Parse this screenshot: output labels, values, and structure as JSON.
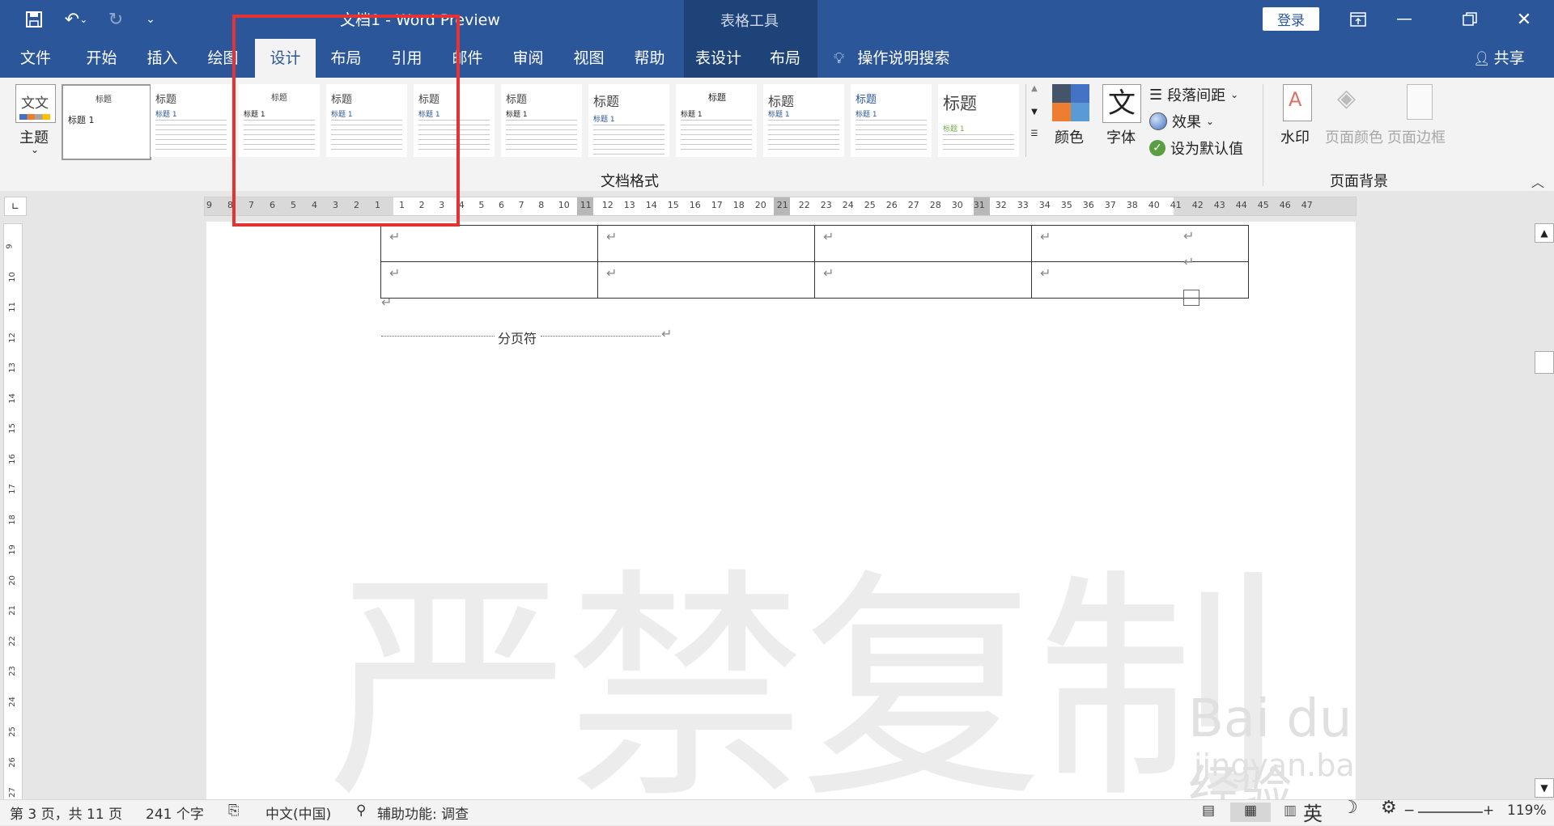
{
  "window": {
    "title": "文档1 - Word Preview",
    "contextual_group": "表格工具",
    "login": "登录"
  },
  "quick_access": {
    "save_icon": "save-icon",
    "undo_icon": "undo-icon",
    "redo_icon": "redo-icon",
    "customize_icon": "customize-icon"
  },
  "tabs": [
    {
      "label": "文件"
    },
    {
      "label": "开始"
    },
    {
      "label": "插入"
    },
    {
      "label": "绘图"
    },
    {
      "label": "设计",
      "active": true
    },
    {
      "label": "布局"
    },
    {
      "label": "引用"
    },
    {
      "label": "邮件"
    },
    {
      "label": "审阅"
    },
    {
      "label": "视图"
    },
    {
      "label": "帮助"
    },
    {
      "label": "表设计"
    },
    {
      "label": "布局"
    }
  ],
  "tell_me": "操作说明搜索",
  "share": "共享",
  "ribbon": {
    "theme_label": "主题",
    "gallery": {
      "items": [
        {
          "head": "标题",
          "sub": "标题 1"
        },
        {
          "head": "标题",
          "sub": "标题 1"
        },
        {
          "head": "标题",
          "sub": "标题 1"
        },
        {
          "head": "标题",
          "sub": "标题 1"
        },
        {
          "head": "标题",
          "sub": "标题 1"
        },
        {
          "head": "标题",
          "sub": "标题 1"
        },
        {
          "head": "标题",
          "sub": "标题 1"
        },
        {
          "head": "标题",
          "sub": "标题 1"
        },
        {
          "head": "标题",
          "sub": "标题 1"
        },
        {
          "head": "标题",
          "sub": "标题 1"
        },
        {
          "head": "标题",
          "sub": "标题 1"
        }
      ],
      "group_label": "文档格式"
    },
    "colors_label": "颜色",
    "fonts_label": "字体",
    "fonts_glyph": "文",
    "paragraph_spacing": "段落间距",
    "effects": "效果",
    "set_default": "设为默认值",
    "watermark": "水印",
    "page_color": "页面颜色",
    "page_borders": "页面边框",
    "page_background_group": "页面背景"
  },
  "ruler": {
    "left_numbers": [
      "9",
      "8",
      "7",
      "6",
      "5",
      "4",
      "3",
      "2",
      "1"
    ],
    "right_numbers": [
      "1",
      "2",
      "3",
      "4",
      "5",
      "6",
      "7",
      "8",
      "10",
      "11",
      "12",
      "13",
      "14",
      "15",
      "16",
      "17",
      "18",
      "20",
      "21",
      "22",
      "23",
      "24",
      "25",
      "26",
      "27",
      "28",
      "30",
      "31",
      "32",
      "33",
      "34",
      "35",
      "36",
      "37",
      "38",
      "40",
      "41",
      "42",
      "43",
      "44",
      "45",
      "46",
      "47"
    ],
    "vertical_numbers": [
      "9",
      "10",
      "11",
      "12",
      "13",
      "14",
      "15",
      "16",
      "17",
      "18",
      "19",
      "20",
      "21",
      "22",
      "23",
      "24",
      "25",
      "26",
      "27"
    ]
  },
  "document": {
    "return_mark": "↵",
    "page_break_label": "分页符",
    "watermark_text": "严禁复制",
    "baidu_logo": "Bai du 经验",
    "baidu_url": "jingyan.baidu.com"
  },
  "status": {
    "page": "第 3 页，共 11 页",
    "words": "241 个字",
    "language": "中文(中国)",
    "accessibility": "辅助功能: 调查",
    "ime": "英",
    "zoom": "119%"
  },
  "colors": {
    "title_bar": "#2b579a",
    "contextual_band": "#1e4379",
    "highlight": "#e53333"
  }
}
